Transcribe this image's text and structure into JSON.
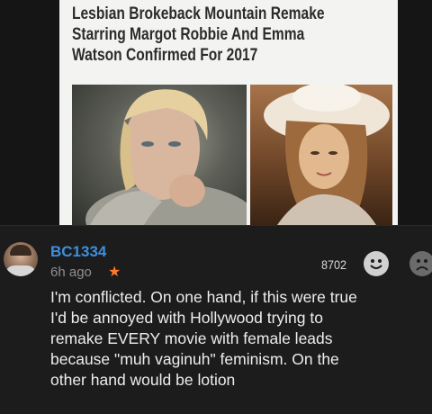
{
  "article": {
    "headline_lines": [
      "Lesbian Brokeback Mountain Remake",
      "Starring Margot Robbie And Emma",
      "Watson Confirmed For 2017"
    ]
  },
  "comment": {
    "username": "BC1334",
    "time": "6h ago",
    "score": "8702",
    "text_lines": [
      "I'm conflicted. On one hand, if this were true",
      "I'd be annoyed with Hollywood trying to",
      "remake EVERY movie with female leads",
      "because \"muh vaginuh\" feminism. On the",
      "other hand would be lotion"
    ]
  },
  "colors": {
    "username": "#3d8fe0",
    "star": "#ff7a2a",
    "background": "#1c1c1c"
  },
  "icons": [
    "star-icon",
    "upvote-smile-icon",
    "downvote-sad-icon"
  ]
}
